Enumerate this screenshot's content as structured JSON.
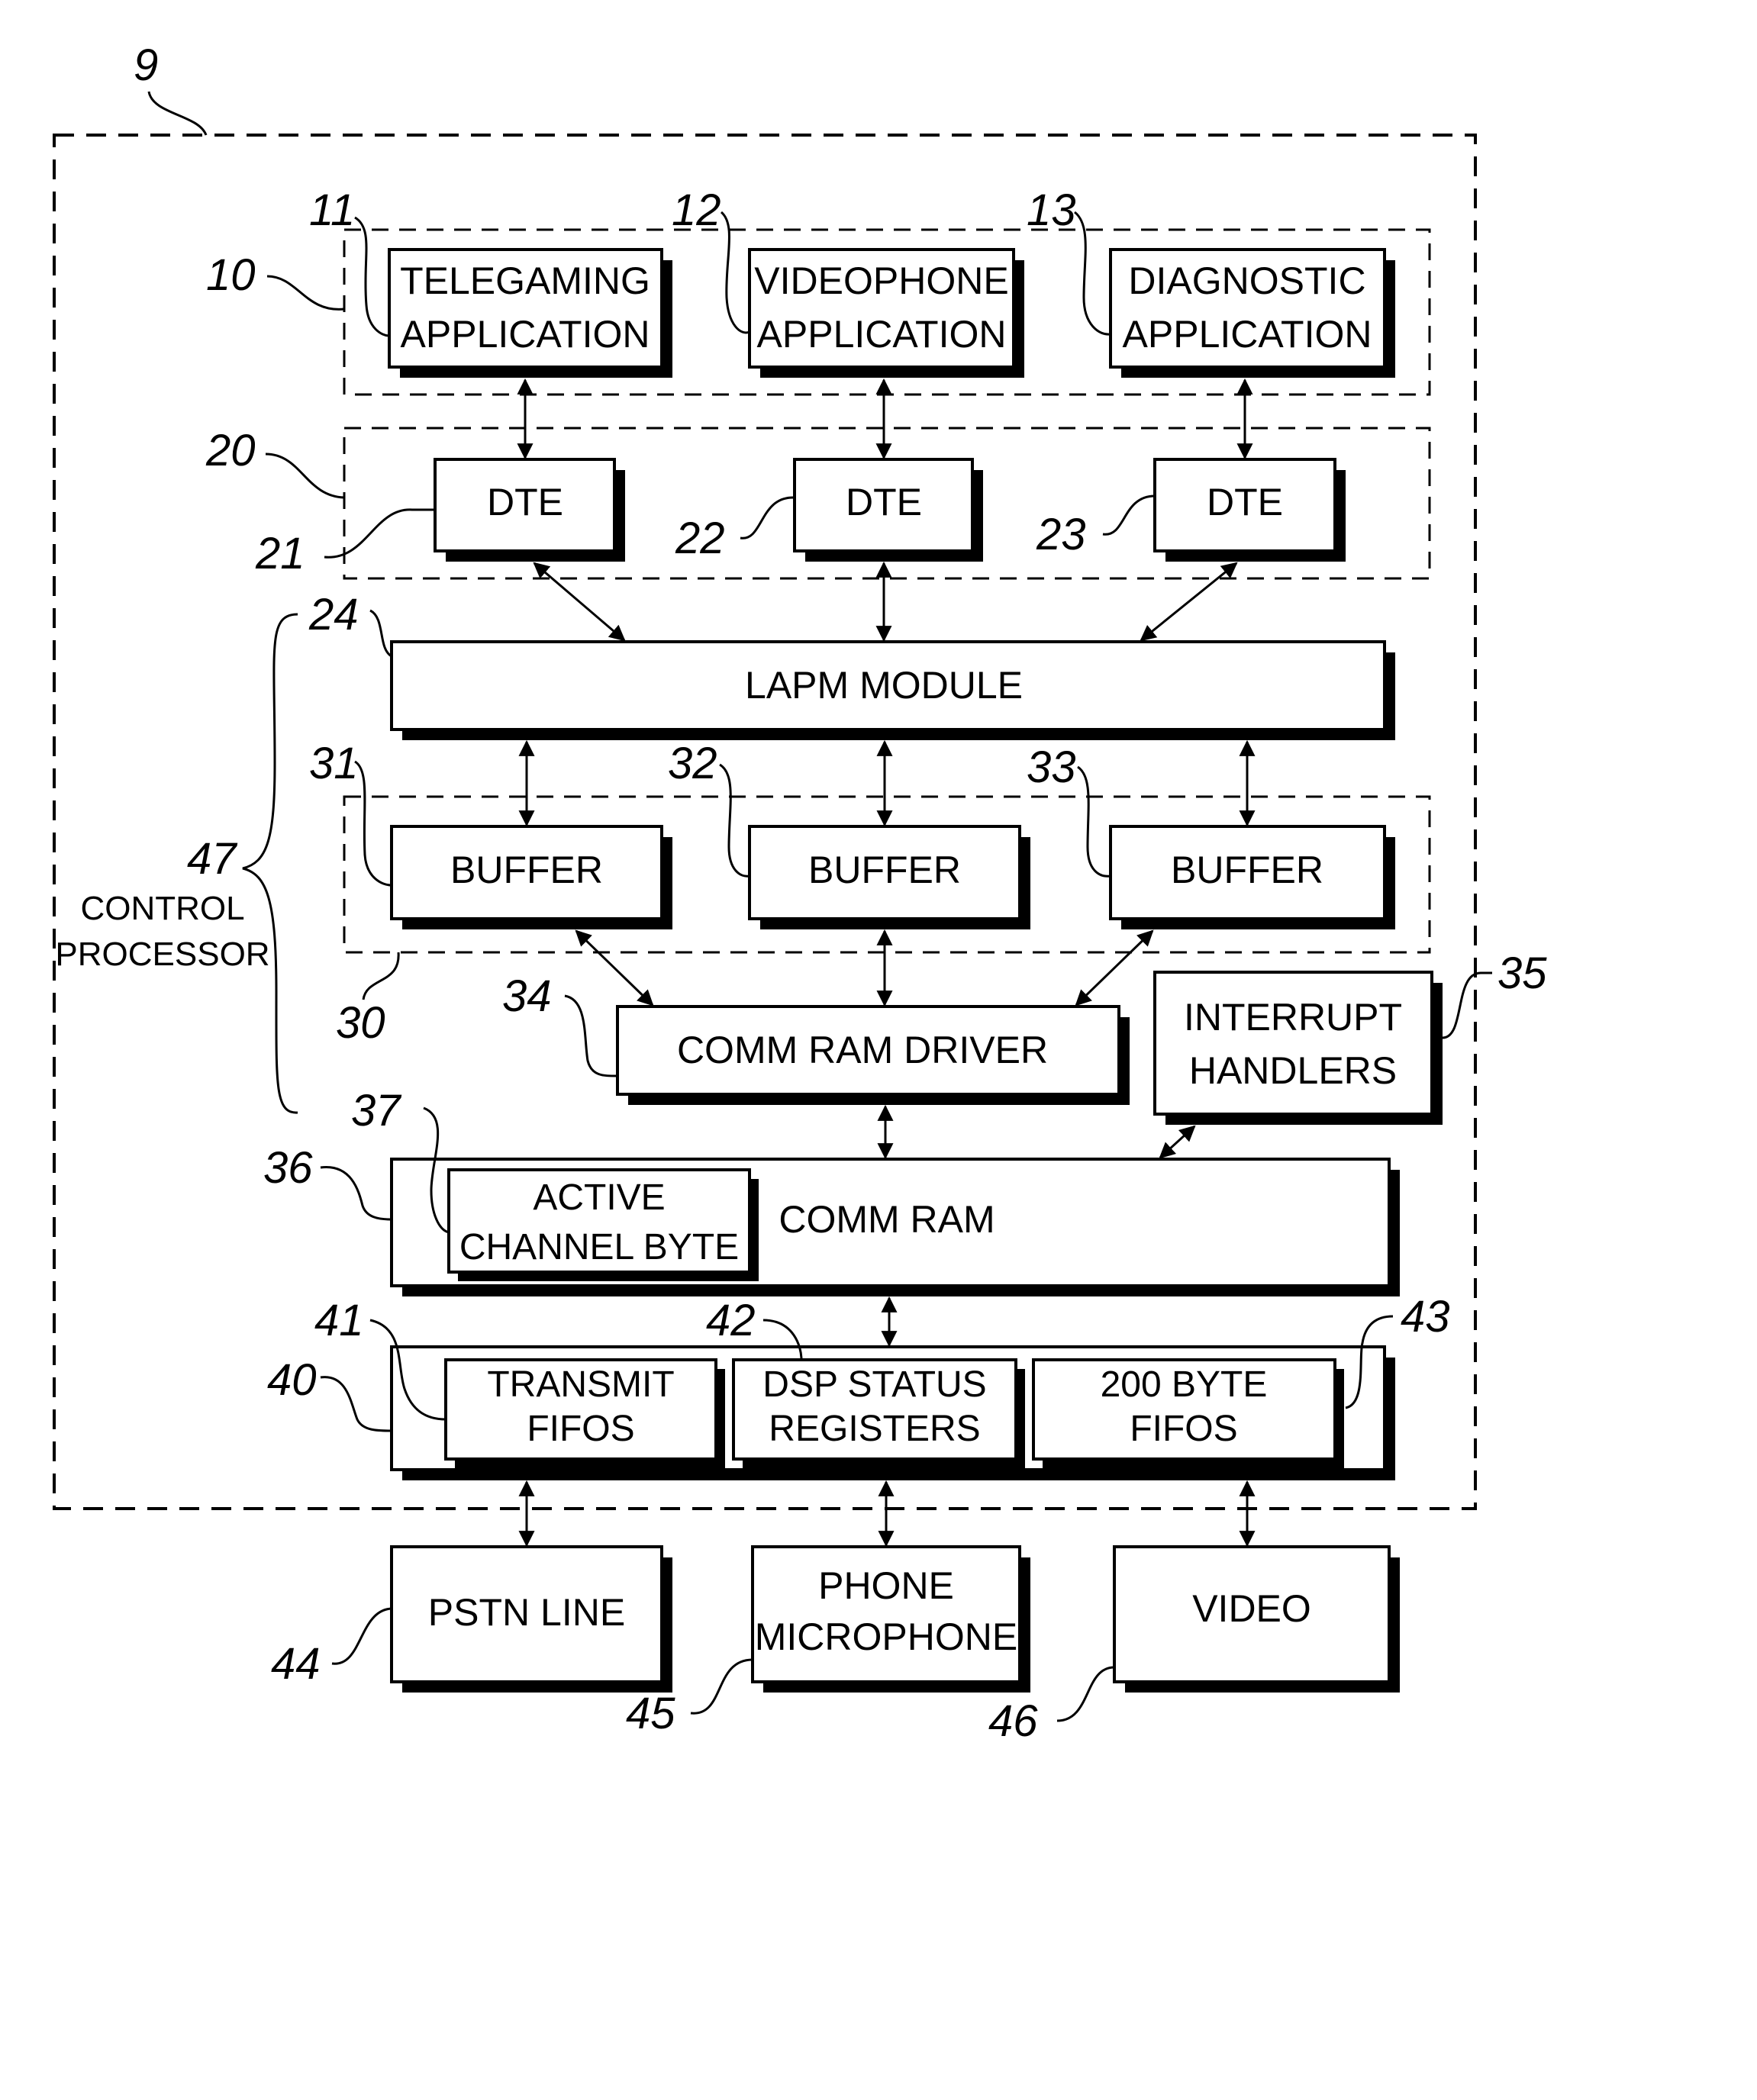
{
  "figure": {
    "system_ref": "9",
    "control_processor": {
      "ref": "47",
      "label_lines": [
        "CONTROL",
        "PROCESSOR"
      ]
    },
    "groups": [
      {
        "id": "applications",
        "ref": "10"
      },
      {
        "id": "dtes",
        "ref": "20"
      },
      {
        "id": "buffers",
        "ref": "30"
      }
    ],
    "applications": [
      {
        "ref": "11",
        "lines": [
          "TELEGAMING",
          "APPLICATION"
        ]
      },
      {
        "ref": "12",
        "lines": [
          "VIDEOPHONE",
          "APPLICATION"
        ]
      },
      {
        "ref": "13",
        "lines": [
          "DIAGNOSTIC",
          "APPLICATION"
        ]
      }
    ],
    "dtes": [
      {
        "ref": "21",
        "label": "DTE"
      },
      {
        "ref": "22",
        "label": "DTE"
      },
      {
        "ref": "23",
        "label": "DTE"
      }
    ],
    "lapm": {
      "ref": "24",
      "label": "LAPM MODULE"
    },
    "buffers": [
      {
        "ref": "31",
        "label": "BUFFER"
      },
      {
        "ref": "32",
        "label": "BUFFER"
      },
      {
        "ref": "33",
        "label": "BUFFER"
      }
    ],
    "comm_ram_driver": {
      "ref": "34",
      "label": "COMM RAM DRIVER"
    },
    "interrupt_handlers": {
      "ref": "35",
      "lines": [
        "INTERRUPT",
        "HANDLERS"
      ]
    },
    "comm_ram": {
      "ref": "36",
      "label": "COMM RAM"
    },
    "active_channel_byte": {
      "ref": "37",
      "lines": [
        "ACTIVE",
        "CHANNEL BYTE"
      ]
    },
    "fifo_block": {
      "ref": "40"
    },
    "fifo_items": [
      {
        "ref": "41",
        "lines": [
          "TRANSMIT",
          "FIFOS"
        ]
      },
      {
        "ref": "42",
        "lines": [
          "DSP STATUS",
          "REGISTERS"
        ]
      },
      {
        "ref": "43",
        "lines": [
          "200 BYTE",
          "FIFOS"
        ]
      }
    ],
    "devices": [
      {
        "ref": "44",
        "lines": [
          "PSTN LINE"
        ]
      },
      {
        "ref": "45",
        "lines": [
          "PHONE",
          "MICROPHONE"
        ]
      },
      {
        "ref": "46",
        "lines": [
          "VIDEO"
        ]
      }
    ]
  }
}
